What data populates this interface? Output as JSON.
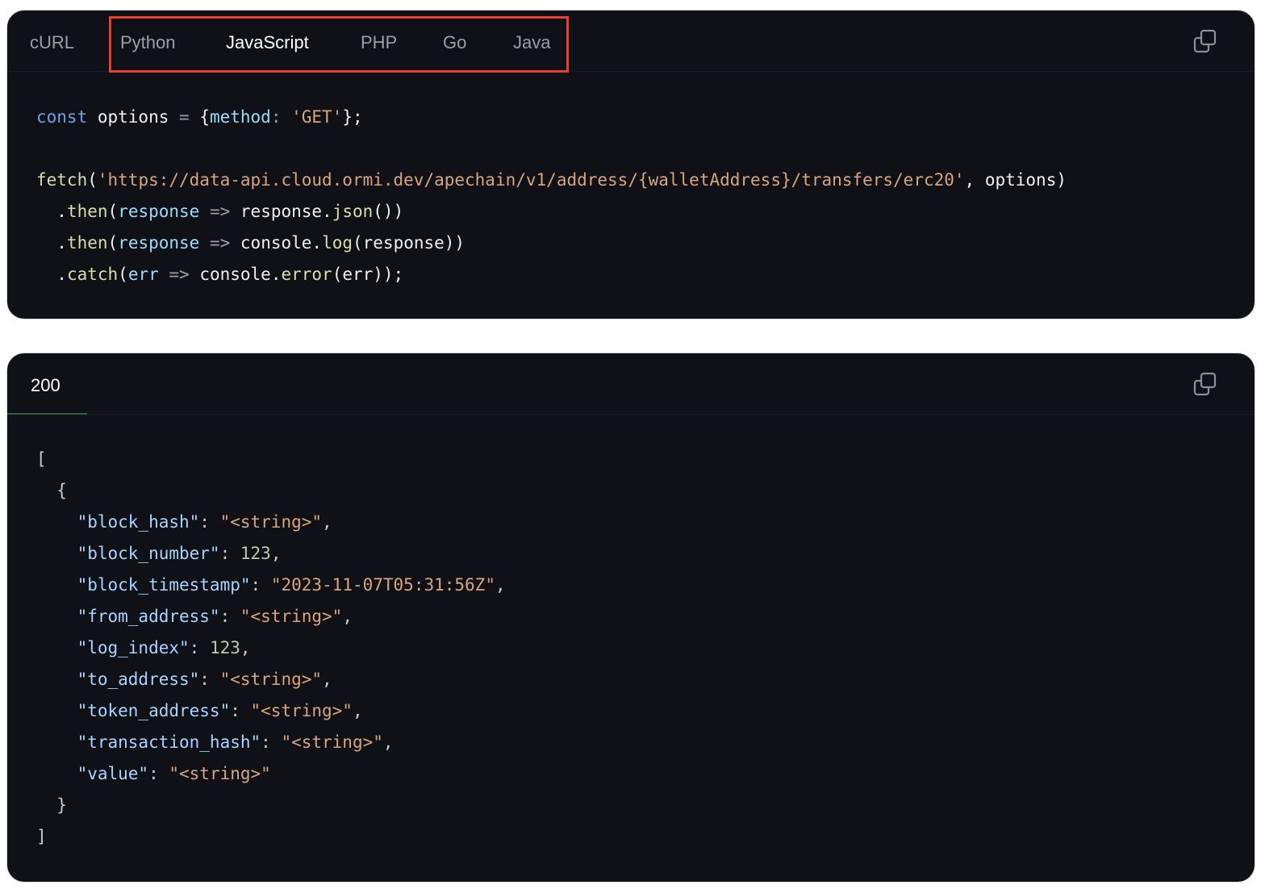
{
  "request": {
    "tabs": [
      "cURL",
      "Python",
      "JavaScript",
      "PHP",
      "Go",
      "Java"
    ],
    "active_tab": "JavaScript",
    "code_lines": [
      [
        {
          "t": "const",
          "c": "kw"
        },
        {
          "t": " options ",
          "c": "plain"
        },
        {
          "t": "=",
          "c": "op"
        },
        {
          "t": " {",
          "c": "plain"
        },
        {
          "t": "method",
          "c": "param"
        },
        {
          "t": ": ",
          "c": "op"
        },
        {
          "t": "'GET'",
          "c": "str"
        },
        {
          "t": "};",
          "c": "plain"
        }
      ],
      [],
      [
        {
          "t": "fetch",
          "c": "fn"
        },
        {
          "t": "(",
          "c": "plain"
        },
        {
          "t": "'https://data-api.cloud.ormi.dev/apechain/v1/address/{walletAddress}/transfers/erc20'",
          "c": "str"
        },
        {
          "t": ", options)",
          "c": "plain"
        }
      ],
      [
        {
          "t": "  .",
          "c": "plain"
        },
        {
          "t": "then",
          "c": "fn"
        },
        {
          "t": "(",
          "c": "plain"
        },
        {
          "t": "response",
          "c": "param"
        },
        {
          "t": " => ",
          "c": "op"
        },
        {
          "t": "response.",
          "c": "plain"
        },
        {
          "t": "json",
          "c": "fn"
        },
        {
          "t": "())",
          "c": "plain"
        }
      ],
      [
        {
          "t": "  .",
          "c": "plain"
        },
        {
          "t": "then",
          "c": "fn"
        },
        {
          "t": "(",
          "c": "plain"
        },
        {
          "t": "response",
          "c": "param"
        },
        {
          "t": " => ",
          "c": "op"
        },
        {
          "t": "console.",
          "c": "plain"
        },
        {
          "t": "log",
          "c": "fn"
        },
        {
          "t": "(response))",
          "c": "plain"
        }
      ],
      [
        {
          "t": "  .",
          "c": "plain"
        },
        {
          "t": "catch",
          "c": "fn"
        },
        {
          "t": "(",
          "c": "plain"
        },
        {
          "t": "err",
          "c": "param"
        },
        {
          "t": " => ",
          "c": "op"
        },
        {
          "t": "console.",
          "c": "plain"
        },
        {
          "t": "error",
          "c": "fn"
        },
        {
          "t": "(err));",
          "c": "plain"
        }
      ]
    ]
  },
  "response": {
    "status": "200",
    "code_lines": [
      [
        {
          "t": "[",
          "c": "punc"
        }
      ],
      [
        {
          "t": "  {",
          "c": "punc"
        }
      ],
      [
        {
          "t": "    \"block_hash\"",
          "c": "key"
        },
        {
          "t": ": ",
          "c": "punc"
        },
        {
          "t": "\"<string>\"",
          "c": "str"
        },
        {
          "t": ",",
          "c": "punc"
        }
      ],
      [
        {
          "t": "    \"block_number\"",
          "c": "key"
        },
        {
          "t": ": ",
          "c": "punc"
        },
        {
          "t": "123",
          "c": "num"
        },
        {
          "t": ",",
          "c": "punc"
        }
      ],
      [
        {
          "t": "    \"block_timestamp\"",
          "c": "key"
        },
        {
          "t": ": ",
          "c": "punc"
        },
        {
          "t": "\"2023-11-07T05:31:56Z\"",
          "c": "str"
        },
        {
          "t": ",",
          "c": "punc"
        }
      ],
      [
        {
          "t": "    \"from_address\"",
          "c": "key"
        },
        {
          "t": ": ",
          "c": "punc"
        },
        {
          "t": "\"<string>\"",
          "c": "str"
        },
        {
          "t": ",",
          "c": "punc"
        }
      ],
      [
        {
          "t": "    \"log_index\"",
          "c": "key"
        },
        {
          "t": ": ",
          "c": "punc"
        },
        {
          "t": "123",
          "c": "num"
        },
        {
          "t": ",",
          "c": "punc"
        }
      ],
      [
        {
          "t": "    \"to_address\"",
          "c": "key"
        },
        {
          "t": ": ",
          "c": "punc"
        },
        {
          "t": "\"<string>\"",
          "c": "str"
        },
        {
          "t": ",",
          "c": "punc"
        }
      ],
      [
        {
          "t": "    \"token_address\"",
          "c": "key"
        },
        {
          "t": ": ",
          "c": "punc"
        },
        {
          "t": "\"<string>\"",
          "c": "str"
        },
        {
          "t": ",",
          "c": "punc"
        }
      ],
      [
        {
          "t": "    \"transaction_hash\"",
          "c": "key"
        },
        {
          "t": ": ",
          "c": "punc"
        },
        {
          "t": "\"<string>\"",
          "c": "str"
        },
        {
          "t": ",",
          "c": "punc"
        }
      ],
      [
        {
          "t": "    \"value\"",
          "c": "key"
        },
        {
          "t": ": ",
          "c": "punc"
        },
        {
          "t": "\"<string>\"",
          "c": "str"
        }
      ],
      [
        {
          "t": "  }",
          "c": "punc"
        }
      ],
      [
        {
          "t": "]",
          "c": "punc"
        }
      ]
    ]
  },
  "icons": {
    "copy": "copy-icon"
  },
  "colors": {
    "panel_bg": "#0f1117",
    "highlight": "#e8402f",
    "status_underline": "#2f5e43"
  }
}
